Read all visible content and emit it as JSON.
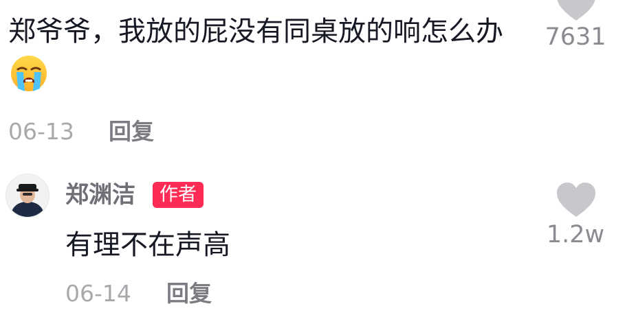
{
  "comment_top": {
    "text": "郑爷爷，我放的屁没有同桌放的响怎么办",
    "emoji": "loudly-crying-face-icon",
    "date": "06-13",
    "reply_label": "回复",
    "like_count": "7631"
  },
  "comment_reply": {
    "author_name": "郑渊洁",
    "author_tag": "作者",
    "text": "有理不在声高",
    "date": "06-14",
    "reply_label": "回复",
    "like_count": "1.2w"
  },
  "colors": {
    "text_primary": "#161823",
    "meta": "#a8a9ad",
    "like_icon": "#c8c8cc",
    "author_tag": "#fe2c55"
  }
}
